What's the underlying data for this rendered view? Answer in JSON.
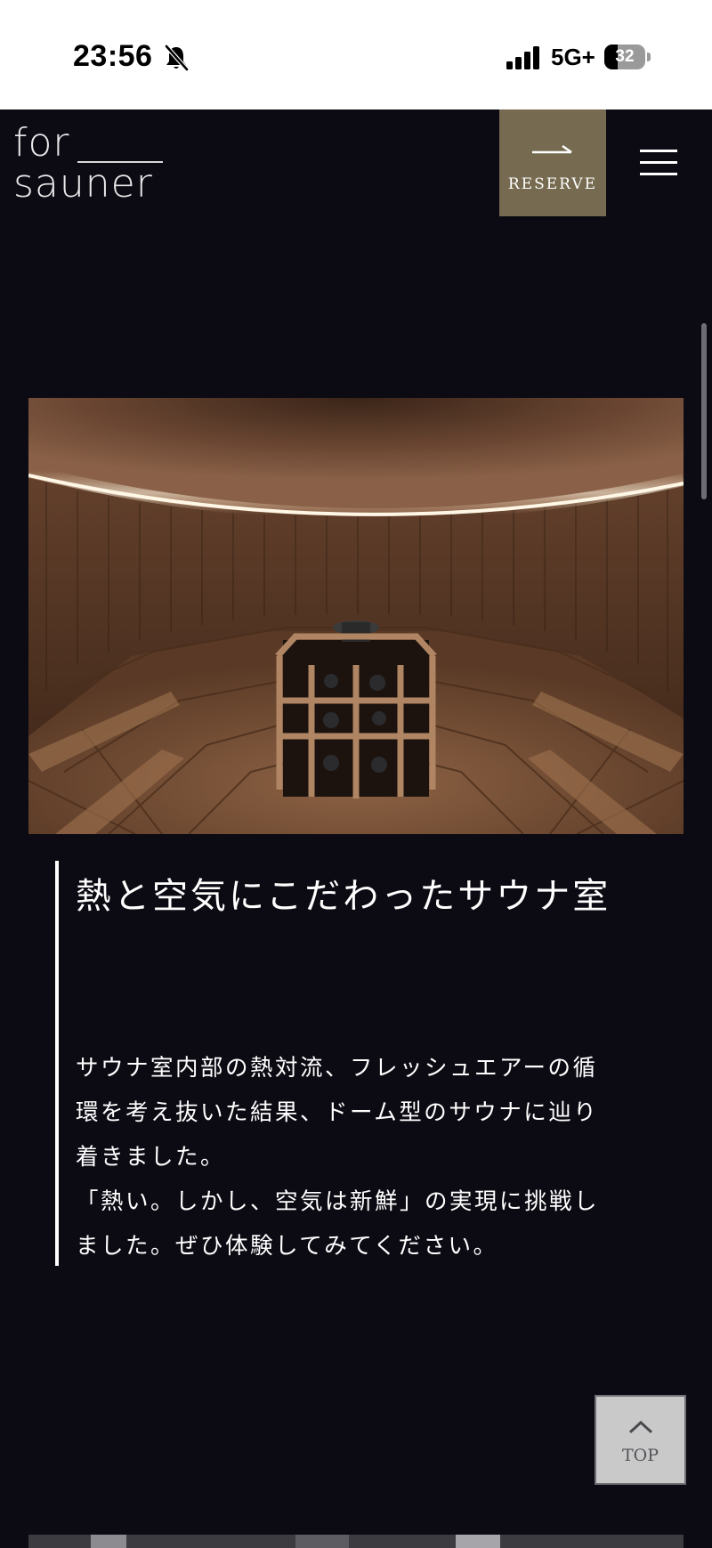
{
  "status_bar": {
    "time": "23:56",
    "network": "5G+",
    "battery_level": "32",
    "battery_fraction": 0.32,
    "icons": [
      "bell-off-icon",
      "signal-icon",
      "battery-icon"
    ]
  },
  "header": {
    "logo_line1": "for",
    "logo_line2": "sauner",
    "reserve_label": "RESERVE",
    "reserve_color": "#766b50",
    "icons": [
      "arrow-right-icon",
      "hamburger-menu-icon"
    ]
  },
  "feature": {
    "title": "熱と空気にこだわったサウナ室",
    "body_lines": [
      "サウナ室内部の熱対流、フレッシュエアーの循",
      "環を考え抜いた結果、ドーム型のサウナに辿り",
      "着きました。",
      "「熱い。しかし、空気は新鮮」の実現に挑戦し",
      "ました。ぜひ体験してみてください。"
    ]
  },
  "back_to_top": {
    "label": "TOP",
    "icon": "chevron-up-icon"
  },
  "colors": {
    "background": "#0c0b13",
    "accent": "#766b50",
    "text": "#ffffff"
  }
}
